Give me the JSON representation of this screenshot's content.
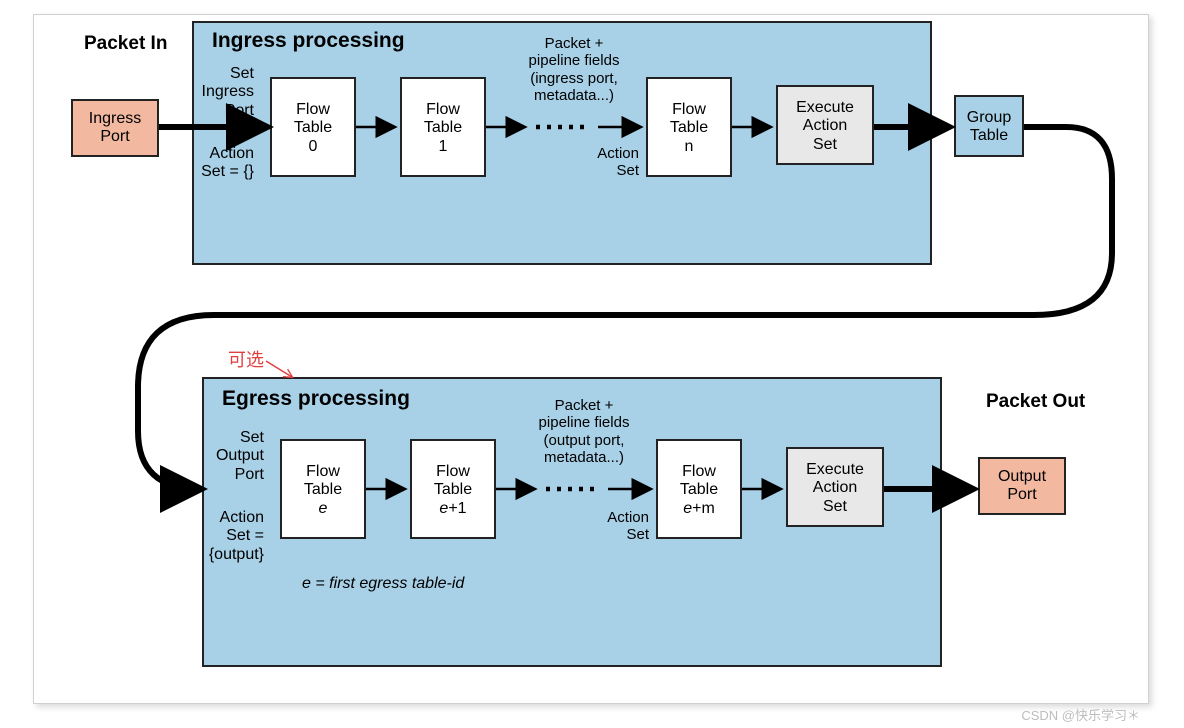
{
  "packetInLabel": "Packet\nIn",
  "ingressPort": "Ingress\nPort",
  "ingress": {
    "title": "Ingress processing",
    "setPort": "Set\nIngress\nPort",
    "actionSetInit": "Action\nSet = {}",
    "ft0": "Flow\nTable\n0",
    "ft1": "Flow\nTable\n1",
    "pipeline": "Packet +\npipeline fields\n(ingress port,\nmetadata...)",
    "actionSet": "Action\nSet",
    "ftn": "Flow\nTable\nn",
    "exec": "Execute\nAction\nSet"
  },
  "groupTable": "Group\nTable",
  "optional": "可选",
  "egress": {
    "title": "Egress processing",
    "setPort": "Set\nOutput\nPort",
    "actionSetInit": "Action\nSet =\n{output}",
    "fte": "Flow\nTable\ne",
    "fte1": "Flow\nTable\ne+1",
    "pipeline": "Packet +\npipeline fields\n(output port,\nmetadata...)",
    "actionSet": "Action\nSet",
    "ftem": "Flow\nTable\ne+m",
    "exec": "Execute\nAction\nSet",
    "footnote": "e = first egress table-id"
  },
  "packetOutLabel": "Packet\nOut",
  "outputPort": "Output\nPort",
  "credit": "CSDN @快乐学习＊"
}
